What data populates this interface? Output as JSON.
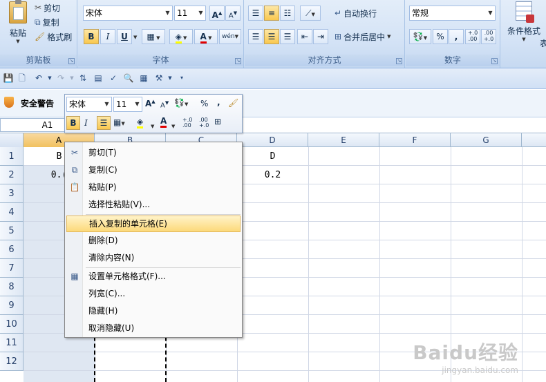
{
  "clipboard": {
    "paste": "粘贴",
    "cut": "剪切",
    "copy": "复制",
    "format_painter": "格式刷",
    "group_label": "剪贴板"
  },
  "font": {
    "name": "宋体",
    "size": "11",
    "bold": "B",
    "italic": "I",
    "underline": "U",
    "grow": "A",
    "shrink": "A",
    "color_a": "A",
    "phonetic": "wén",
    "group_label": "字体"
  },
  "alignment": {
    "wrap_text": "自动换行",
    "merge_center": "合并后居中",
    "group_label": "对齐方式"
  },
  "number": {
    "format": "常规",
    "percent": "%",
    "comma": ",",
    "inc_dec": "+.0\n.00",
    "dec_dec": ".00\n+.0",
    "group_label": "数字"
  },
  "styles": {
    "conditional_format": "条件格式",
    "cut_off": "表"
  },
  "security": {
    "warning": "安全警告"
  },
  "mini_toolbar": {
    "font_name": "宋体",
    "font_size": "11",
    "bold": "B",
    "italic": "I",
    "percent": "%",
    "comma": ","
  },
  "formula_bar": {
    "name_box": "A1"
  },
  "columns": [
    "A",
    "B",
    "C",
    "D",
    "E",
    "F",
    "G"
  ],
  "rows": [
    "1",
    "2",
    "3",
    "4",
    "5",
    "6",
    "7",
    "8",
    "9",
    "10",
    "11",
    "12"
  ],
  "cells": {
    "A1": "B",
    "A2": "0.(",
    "D1": "D",
    "D2": "0.2"
  },
  "context_menu": [
    {
      "label": "剪切(T)",
      "icon": "scissors-icon"
    },
    {
      "label": "复制(C)",
      "icon": "copy-icon"
    },
    {
      "label": "粘贴(P)",
      "icon": "paste-icon"
    },
    {
      "label": "选择性粘贴(V)..."
    },
    {
      "label": "插入复制的单元格(E)",
      "highlighted": true
    },
    {
      "label": "删除(D)"
    },
    {
      "label": "清除内容(N)"
    },
    {
      "label": "设置单元格格式(F)...",
      "icon": "format-cells-icon"
    },
    {
      "label": "列宽(C)..."
    },
    {
      "label": "隐藏(H)"
    },
    {
      "label": "取消隐藏(U)"
    }
  ],
  "watermark": {
    "brand": "Baidu经验",
    "url": "jingyan.baidu.com"
  },
  "colors": {
    "accent": "#fcd97a",
    "ribbon": "#d4e3f6",
    "font_color_bar": "#e00000",
    "fill_color_bar": "#ffff00"
  }
}
